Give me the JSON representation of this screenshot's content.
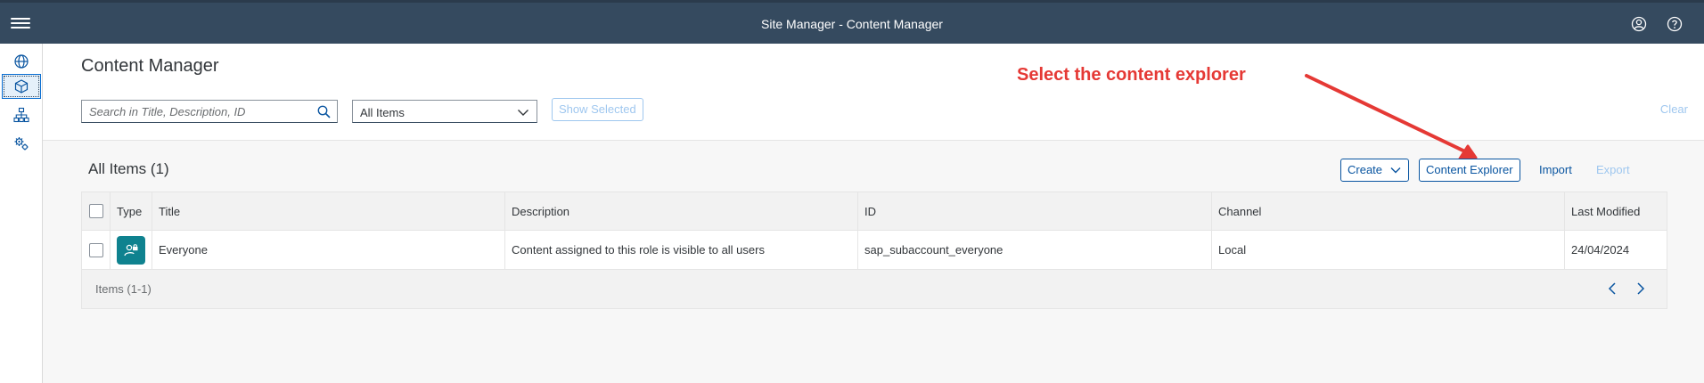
{
  "shell": {
    "title": "Site Manager - Content Manager",
    "menu_icon": "hamburger-menu-icon",
    "profile_icon": "user-profile-icon",
    "help_icon": "help-icon"
  },
  "sidenav": {
    "items": [
      {
        "icon": "globe-icon",
        "active": false
      },
      {
        "icon": "content-cube-icon",
        "active": true
      },
      {
        "icon": "hierarchy-icon",
        "active": false
      },
      {
        "icon": "settings-gears-icon",
        "active": false
      }
    ]
  },
  "header": {
    "title": "Content Manager",
    "search_placeholder": "Search in Title, Description, ID",
    "filter_value": "All Items",
    "show_selected_label": "Show Selected",
    "clear_label": "Clear"
  },
  "annotation": {
    "text": "Select the content explorer",
    "color": "#e53935"
  },
  "content": {
    "section_title": "All Items (1)",
    "create_label": "Create",
    "explorer_label": "Content Explorer",
    "import_label": "Import",
    "export_label": "Export"
  },
  "table": {
    "columns": [
      "Type",
      "Title",
      "Description",
      "ID",
      "Channel",
      "Last Modified"
    ],
    "rows": [
      {
        "type_icon": "role-icon",
        "title": "Everyone",
        "description": "Content assigned to this role is visible to all users",
        "id": "sap_subaccount_everyone",
        "channel": "Local",
        "last_modified": "24/04/2024"
      }
    ],
    "footer_count": "Items (1-1)"
  },
  "colors": {
    "shell_bg": "#354a5f",
    "accent": "#0854a0",
    "role_badge": "#0f828f"
  }
}
